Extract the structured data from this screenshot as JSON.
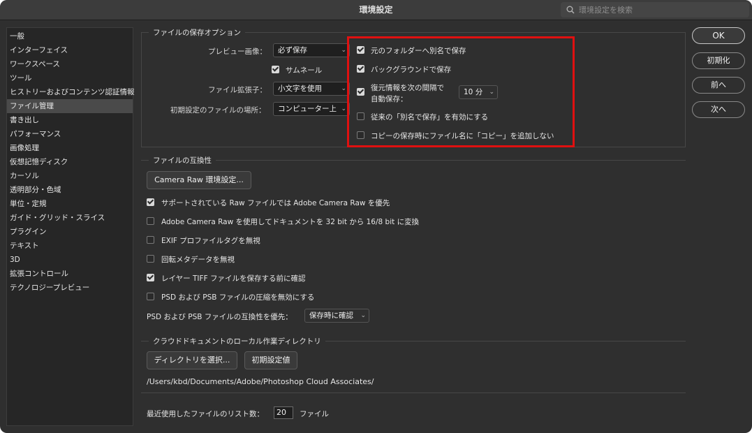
{
  "window": {
    "title": "環境設定"
  },
  "search": {
    "placeholder": "環境設定を検索"
  },
  "sidebar": {
    "items": [
      "一般",
      "インターフェイス",
      "ワークスペース",
      "ツール",
      "ヒストリーおよびコンテンツ認証情報",
      "ファイル管理",
      "書き出し",
      "パフォーマンス",
      "画像処理",
      "仮想記憶ディスク",
      "カーソル",
      "透明部分・色域",
      "単位・定規",
      "ガイド・グリッド・スライス",
      "プラグイン",
      "テキスト",
      "3D",
      "拡張コントロール",
      "テクノロジープレビュー"
    ],
    "active_index": 5
  },
  "save_options": {
    "legend": "ファイルの保存オプション",
    "preview_label": "プレビュー画像：",
    "preview_value": "必ず保存",
    "thumbnail_label": "サムネール",
    "thumbnail_checked": true,
    "extension_label": "ファイル拡張子：",
    "extension_value": "小文字を使用",
    "location_label": "初期設定のファイルの場所：",
    "location_value": "コンピューター上",
    "save_as_original_label": "元のフォルダーへ別名で保存",
    "save_as_original_checked": true,
    "background_save_label": "バックグラウンドで保存",
    "background_save_checked": true,
    "autosave_label_line1": "復元情報を次の間隔で",
    "autosave_label_line2": "自動保存：",
    "autosave_checked": true,
    "autosave_interval": "10 分",
    "legacy_save_as_label": "従来の「別名で保存」を有効にする",
    "legacy_save_as_checked": false,
    "no_copy_suffix_label": "コピーの保存時にファイル名に「コピー」を追加しない",
    "no_copy_suffix_checked": false
  },
  "compatibility": {
    "legend": "ファイルの互換性",
    "camera_raw_button": "Camera Raw 環境設定...",
    "options": [
      {
        "label": "サポートされている Raw ファイルでは Adobe Camera Raw を優先",
        "checked": true
      },
      {
        "label": "Adobe Camera Raw を使用してドキュメントを 32 bit から 16/8 bit に変換",
        "checked": false
      },
      {
        "label": "EXIF プロファイルタグを無視",
        "checked": false
      },
      {
        "label": "回転メタデータを無視",
        "checked": false
      },
      {
        "label": "レイヤー TIFF ファイルを保存する前に確認",
        "checked": true
      },
      {
        "label": "PSD および PSB ファイルの圧縮を無効にする",
        "checked": false
      }
    ],
    "psd_compat_label": "PSD および PSB ファイルの互換性を優先：",
    "psd_compat_value": "保存時に確認"
  },
  "cloud": {
    "legend": "クラウドドキュメントのローカル作業ディレクトリ",
    "select_dir_button": "ディレクトリを選択...",
    "default_button": "初期設定値",
    "path": "/Users/kbd/Documents/Adobe/Photoshop Cloud Associates/"
  },
  "recent": {
    "label": "最近使用したファイルのリスト数：",
    "value": "20",
    "unit": "ファイル"
  },
  "buttons": {
    "ok": "OK",
    "reset": "初期化",
    "prev": "前へ",
    "next": "次へ"
  }
}
